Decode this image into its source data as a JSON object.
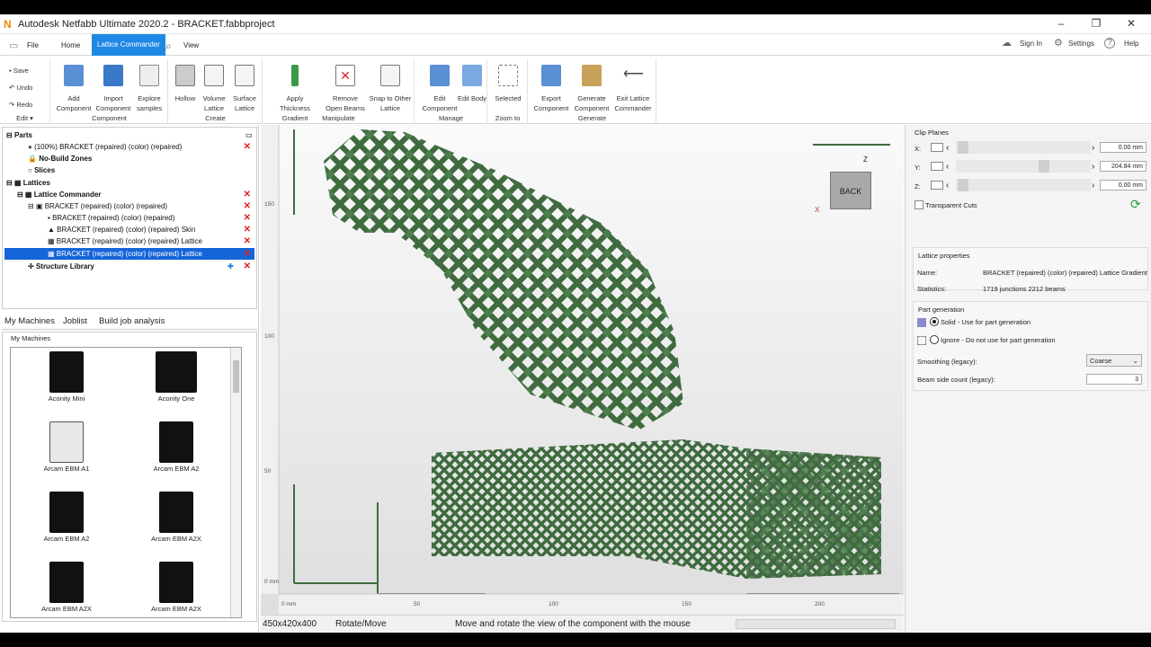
{
  "window": {
    "title": "Autodesk Netfabb Ultimate 2020.2 - BRACKET.fabbproject",
    "min": "–",
    "max": "❐",
    "close": "✕"
  },
  "menu": {
    "file": "File",
    "home": "Home",
    "lattice": "Lattice Commander",
    "view": "View",
    "signin": "Sign In",
    "settings": "Settings",
    "help": "Help"
  },
  "ribbon": {
    "edit": {
      "save": "Save",
      "undo": "Undo",
      "redo": "Redo",
      "label": "Edit ▾"
    },
    "component": {
      "add": "Add Component",
      "import": "Import Component",
      "explore": "Explore samples",
      "label": "Component"
    },
    "create": {
      "hollow": "Hollow",
      "volume": "Volume Lattice",
      "surface": "Surface Lattice",
      "label": "Create"
    },
    "manipulate": {
      "thickness": "Apply Thickness Gradient",
      "remove": "Remove Open Beams",
      "snap": "Snap to Other Lattice",
      "label": "Manipulate"
    },
    "manage": {
      "editcomp": "Edit Component",
      "editbody": "Edit Body",
      "label": "Manage"
    },
    "zoom": {
      "selected": "Selected",
      "label": "Zoom to"
    },
    "generate": {
      "export": "Export Component",
      "gencomp": "Generate Component",
      "exit": "Exit Lattice Commander",
      "label": "Generate"
    }
  },
  "tree": {
    "parts": "Parts",
    "part1": "(100%) BRACKET  (repaired) (color) (repaired)",
    "nobuild": "No-Build Zones",
    "slices": "Slices",
    "lattices": "Lattices",
    "lc": "Lattice Commander",
    "bracket": "BRACKET  (repaired) (color) (repaired)",
    "c1": "BRACKET  (repaired) (color) (repaired)",
    "c2": "BRACKET  (repaired) (color) (repaired) Skin",
    "c3": "BRACKET  (repaired) (color) (repaired) Lattice",
    "c4": "BRACKET  (repaired) (color) (repaired) Lattice",
    "structlib": "Structure Library"
  },
  "machines": {
    "tabs": [
      "My Machines",
      "Joblist",
      "Build job analysis"
    ],
    "header": "My Machines",
    "items": [
      "Aconity Mini",
      "Aconity One",
      "Arcam EBM A1",
      "Arcam EBM A2",
      "Arcam EBM A2",
      "Arcam EBM A2X",
      "Arcam EBM A2X",
      "Arcam EBM A2X"
    ]
  },
  "viewport": {
    "cube": "BACK",
    "xticks": [
      "0 mm",
      "50",
      "100",
      "150",
      "200"
    ],
    "yticks": [
      "150",
      "100",
      "50",
      "0 mm"
    ],
    "axis_z": "Z",
    "axis_x": "X"
  },
  "clip": {
    "title": "Clip Planes",
    "x": "X:",
    "y": "Y:",
    "z": "Z:",
    "xval": "0.00 mm",
    "yval": "204.84 mm",
    "zval": "0.00 mm",
    "transparent": "Transparent Cuts"
  },
  "props": {
    "title": "Lattice properties",
    "name_label": "Name:",
    "name_val": "BRACKET  (repaired) (color) (repaired) Lattice Gradient",
    "stats_label": "Statistics:",
    "stats_val": "1719 junctions 2212 beams",
    "partgen": "Part generation",
    "solid": "Solid - Use for part generation",
    "ignore": "Ignore - Do not use for part generation",
    "smooth_label": "Smoothing (legacy):",
    "smooth_val": "Coarse",
    "beam_label": "Beam side count (legacy):",
    "beam_val": "3"
  },
  "status": {
    "dims": "450x420x400",
    "mode": "Rotate/Move",
    "hint": "Move and rotate the view of the component with the mouse"
  },
  "colors": {
    "accent": "#1e88e5",
    "lattice": "#3f6b3f",
    "delete": "#e02020"
  }
}
